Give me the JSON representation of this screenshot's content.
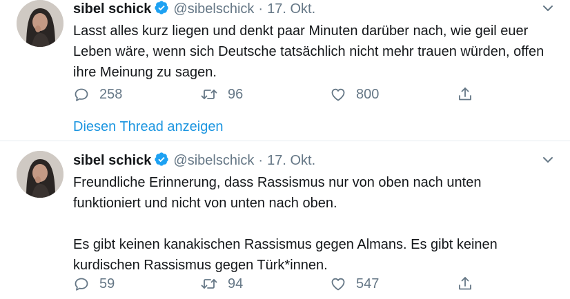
{
  "tweets": [
    {
      "author_name": "sibel schick",
      "handle": "@sibelschick",
      "separator": "·",
      "date": "17. Okt.",
      "text": "Lasst alles kurz liegen und denkt paar Minuten darüber nach, wie geil euer Leben wäre, wenn sich Deutsche tatsächlich nicht mehr trauen würden, offen ihre Meinung zu sagen.",
      "replies": "258",
      "retweets": "96",
      "likes": "800",
      "thread_link": "Diesen Thread anzeigen"
    },
    {
      "author_name": "sibel schick",
      "handle": "@sibelschick",
      "separator": "·",
      "date": "17. Okt.",
      "text": "Freundliche Erinnerung, dass Rassismus nur von oben nach unten\nfunktioniert und nicht von unten nach oben.\n\nEs gibt keinen kanakischen Rassismus gegen Almans. Es gibt keinen\nkurdischen Rassismus gegen Türk*innen.",
      "replies": "59",
      "retweets": "94",
      "likes": "547"
    }
  ],
  "colors": {
    "text": "#14171a",
    "secondary": "#657786",
    "link": "#1b95e0",
    "verified": "#1da1f2",
    "divider": "#e6ecf0"
  },
  "icons": [
    "verified-badge-icon",
    "chevron-down-icon",
    "reply-icon",
    "retweet-icon",
    "like-icon",
    "share-icon"
  ]
}
